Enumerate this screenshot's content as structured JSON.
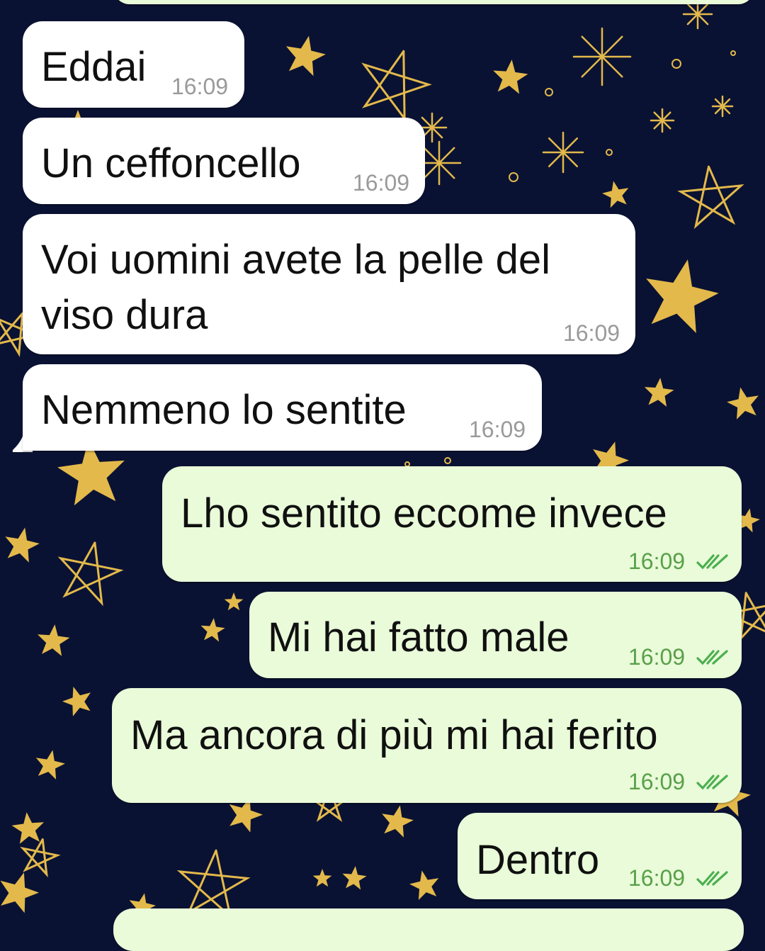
{
  "chat": {
    "theme": {
      "wallpaper_color": "#0a1233",
      "star_color": "#e3b94b",
      "incoming_bubble_color": "#ffffff",
      "outgoing_bubble_color": "#e9fbd9",
      "outgoing_time_color": "#5aa04a",
      "read_ticks_color": "#4caf50"
    },
    "messages": [
      {
        "direction": "incoming",
        "text": "Eddai",
        "time": "16:09"
      },
      {
        "direction": "incoming",
        "text": "Un ceffoncello",
        "time": "16:09"
      },
      {
        "direction": "incoming",
        "text_line1": "Voi uomini avete la pelle del",
        "text_line2": "viso dura",
        "time": "16:09"
      },
      {
        "direction": "incoming",
        "text": "Nemmeno lo sentite",
        "time": "16:09"
      },
      {
        "direction": "outgoing",
        "text": "Lho sentito eccome invece",
        "time": "16:09",
        "status": "read"
      },
      {
        "direction": "outgoing",
        "text": "Mi hai fatto male",
        "time": "16:09",
        "status": "read"
      },
      {
        "direction": "outgoing",
        "text": "Ma ancora di più mi hai ferito",
        "time": "16:09",
        "status": "read"
      },
      {
        "direction": "outgoing",
        "text": "Dentro",
        "time": "16:09",
        "status": "read"
      }
    ]
  }
}
